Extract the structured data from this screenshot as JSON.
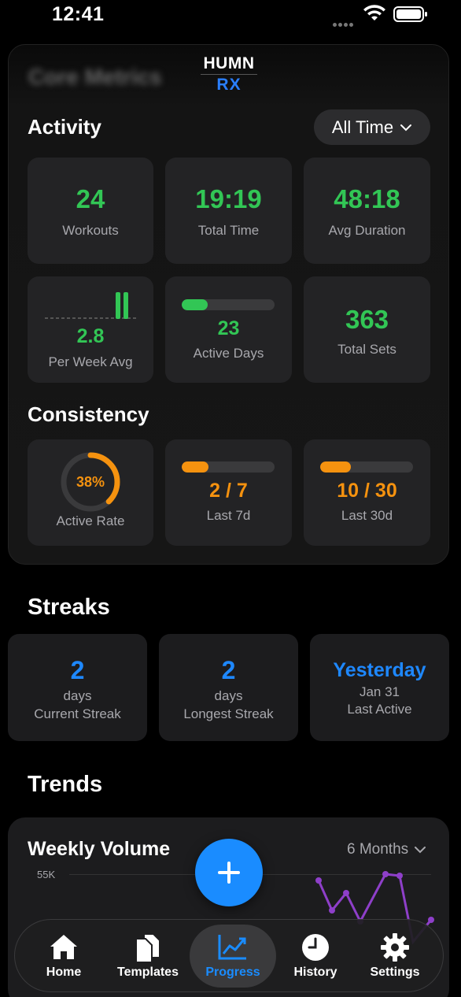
{
  "status": {
    "time": "12:41"
  },
  "logo": {
    "top": "HUMN",
    "bottom": "RX"
  },
  "core": {
    "title": "Core Metrics",
    "activity": {
      "heading": "Activity",
      "filter": "All Time",
      "tiles": [
        {
          "value": "24",
          "label": "Workouts"
        },
        {
          "value": "19:19",
          "label": "Total Time"
        },
        {
          "value": "48:18",
          "label": "Avg Duration"
        },
        {
          "value": "2.8",
          "label": "Per Week Avg"
        },
        {
          "value": "23",
          "label": "Active Days",
          "fill": 0.28
        },
        {
          "value": "363",
          "label": "Total Sets"
        }
      ]
    },
    "consistency": {
      "heading": "Consistency",
      "active_rate": {
        "value": "38%",
        "label": "Active Rate",
        "fraction": 0.38
      },
      "last7": {
        "value": "2 / 7",
        "label": "Last 7d",
        "fill": 0.2857
      },
      "last30": {
        "value": "10 / 30",
        "label": "Last 30d",
        "fill": 0.3333
      }
    }
  },
  "streaks": {
    "heading": "Streaks",
    "current": {
      "value": "2",
      "unit": "days",
      "label": "Current Streak"
    },
    "longest": {
      "value": "2",
      "unit": "days",
      "label": "Longest Streak"
    },
    "last_active": {
      "value": "Yesterday",
      "date": "Jan 31",
      "label": "Last Active"
    }
  },
  "trends": {
    "heading": "Trends",
    "weekly_volume": {
      "title": "Weekly Volume",
      "range": "6 Months",
      "ytick": "55K"
    }
  },
  "tabs": [
    {
      "label": "Home",
      "icon": "home-icon"
    },
    {
      "label": "Templates",
      "icon": "templates-icon"
    },
    {
      "label": "Progress",
      "icon": "progress-chart-icon",
      "active": true
    },
    {
      "label": "History",
      "icon": "clock-icon"
    },
    {
      "label": "Settings",
      "icon": "gear-icon"
    }
  ],
  "colors": {
    "green": "#32c655",
    "orange": "#f5920f",
    "blue": "#1e88ff",
    "purple": "#8e3fc9"
  }
}
